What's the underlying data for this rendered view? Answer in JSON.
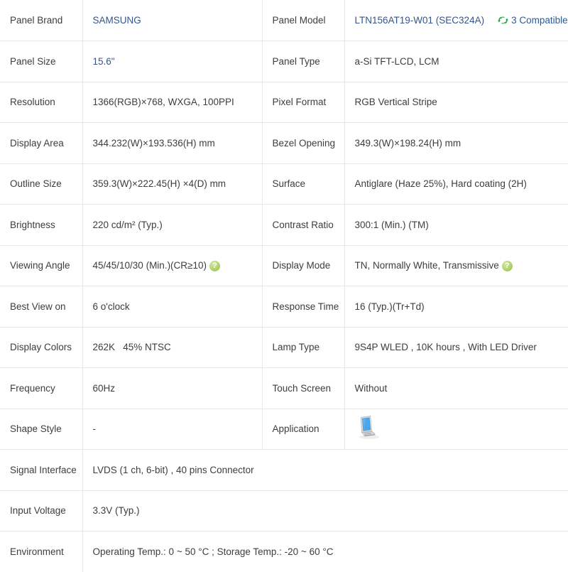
{
  "table": {
    "rows": [
      {
        "left_label": "Panel Brand",
        "left_value": "SAMSUNG",
        "right_label": "Panel Model",
        "right_value": "LTN156AT19-W01 (SEC324A)",
        "right_badge": "3 Compatible"
      },
      {
        "left_label": "Panel Size",
        "left_value": "15.6\"",
        "right_label": "Panel Type",
        "right_value": "a-Si TFT-LCD, LCM"
      },
      {
        "left_label": "Resolution",
        "left_value": "1366(RGB)×768, WXGA, 100PPI",
        "right_label": "Pixel Format",
        "right_value": "RGB Vertical Stripe"
      },
      {
        "left_label": "Display Area",
        "left_value": "344.232(W)×193.536(H) mm",
        "right_label": "Bezel Opening",
        "right_value": "349.3(W)×198.24(H) mm"
      },
      {
        "left_label": "Outline Size",
        "left_value": "359.3(W)×222.45(H) ×4(D) mm",
        "right_label": "Surface",
        "right_value": "Antiglare (Haze 25%), Hard coating (2H)"
      },
      {
        "left_label": "Brightness",
        "left_value": "220 cd/m² (Typ.)",
        "right_label": "Contrast Ratio",
        "right_value": "300:1 (Min.) (TM)"
      },
      {
        "left_label": "Viewing Angle",
        "left_value": "45/45/10/30 (Min.)(CR≥10)",
        "left_help": "?",
        "right_label": "Display Mode",
        "right_value": "TN, Normally White, Transmissive",
        "right_help": "?"
      },
      {
        "left_label": "Best View on",
        "left_value": "6 o'clock",
        "right_label": "Response Time",
        "right_value": "16 (Typ.)(Tr+Td)"
      },
      {
        "left_label": "Display Colors",
        "left_value": "262K   45% NTSC",
        "right_label": "Lamp Type",
        "right_value": "9S4P WLED , 10K hours , With LED Driver"
      },
      {
        "left_label": "Frequency",
        "left_value": "60Hz",
        "right_label": "Touch Screen",
        "right_value": "Without"
      },
      {
        "left_label": "Shape Style",
        "left_value": "-",
        "right_label": "Application",
        "right_value": "",
        "right_icon": "laptop-icon"
      }
    ],
    "full_rows": [
      {
        "label": "Signal Interface",
        "value": "LVDS (1 ch, 6-bit) , 40 pins Connector"
      },
      {
        "label": "Input Voltage",
        "value": "3.3V (Typ.)"
      },
      {
        "label": "Environment",
        "value": "Operating Temp.: 0 ~ 50 °C ; Storage Temp.: -20 ~ 60 °C"
      }
    ]
  },
  "colors": {
    "link": "#34558b",
    "border": "#e8e8e8",
    "text": "#3d3d3d",
    "help_badge": "#a8ce5c",
    "recycle": "#1f9a3c",
    "compatible_text": "#2d5a93"
  },
  "icons": {
    "recycle": "recycle-icon",
    "help": "help-icon",
    "laptop": "laptop-icon"
  }
}
